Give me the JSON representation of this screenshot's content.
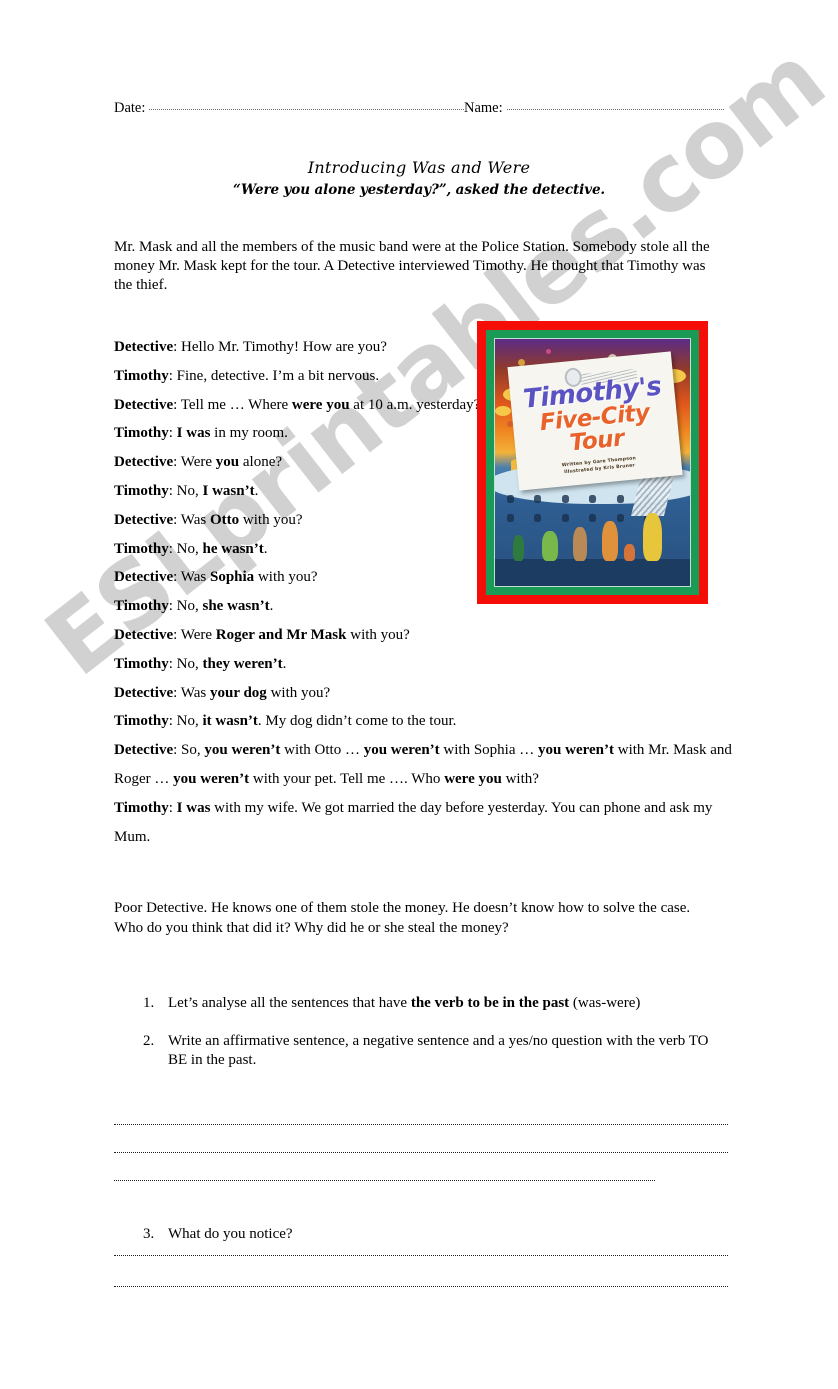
{
  "watermark": {
    "text": "ESLprintables.com"
  },
  "header": {
    "date_label": "Date:",
    "name_label": "Name:"
  },
  "titles": {
    "main": "Introducing Was and Were",
    "sub": "“Were you alone yesterday?”, asked the detective."
  },
  "intro": "Mr. Mask and all the members of the music band were at the Police Station. Somebody stole all the money Mr. Mask kept for the tour. A Detective interviewed Timothy. He thought that Timothy was the thief.",
  "dialogue": [
    {
      "speaker": "Detective",
      "parts": [
        {
          "t": ": Hello Mr. Timothy! How are you?",
          "b": false
        }
      ]
    },
    {
      "speaker": "Timothy",
      "parts": [
        {
          "t": ": Fine, detective. I’m a bit nervous.",
          "b": false
        }
      ]
    },
    {
      "speaker": "Detective",
      "parts": [
        {
          "t": ": Tell me … Where ",
          "b": false
        },
        {
          "t": "were you",
          "b": true
        },
        {
          "t": " at 10 a.m. yesterday?",
          "b": false
        }
      ]
    },
    {
      "speaker": "Timothy",
      "parts": [
        {
          "t": ": ",
          "b": false
        },
        {
          "t": "I was",
          "b": true
        },
        {
          "t": " in my room.",
          "b": false
        }
      ]
    },
    {
      "speaker": "Detective",
      "parts": [
        {
          "t": ": Were ",
          "b": false
        },
        {
          "t": "you",
          "b": true
        },
        {
          "t": " alone?",
          "b": false
        }
      ]
    },
    {
      "speaker": "Timothy",
      "parts": [
        {
          "t": ": No, ",
          "b": false
        },
        {
          "t": "I wasn’t",
          "b": true
        },
        {
          "t": ".",
          "b": false
        }
      ]
    },
    {
      "speaker": "Detective",
      "parts": [
        {
          "t": ": Was ",
          "b": false
        },
        {
          "t": "Otto",
          "b": true
        },
        {
          "t": " with you?",
          "b": false
        }
      ]
    },
    {
      "speaker": "Timothy",
      "parts": [
        {
          "t": ": No, ",
          "b": false
        },
        {
          "t": "he wasn’t",
          "b": true
        },
        {
          "t": ".",
          "b": false
        }
      ]
    },
    {
      "speaker": "Detective",
      "parts": [
        {
          "t": ": Was ",
          "b": false
        },
        {
          "t": "Sophia",
          "b": true
        },
        {
          "t": " with you?",
          "b": false
        }
      ]
    },
    {
      "speaker": "Timothy",
      "parts": [
        {
          "t": ": No, ",
          "b": false
        },
        {
          "t": "she wasn’t",
          "b": true
        },
        {
          "t": ".",
          "b": false
        }
      ]
    },
    {
      "speaker": "Detective",
      "parts": [
        {
          "t": ": Were ",
          "b": false
        },
        {
          "t": "Roger and Mr Mask",
          "b": true
        },
        {
          "t": " with you?",
          "b": false
        }
      ]
    },
    {
      "speaker": "Timothy",
      "parts": [
        {
          "t": ": No, ",
          "b": false
        },
        {
          "t": "they weren’t",
          "b": true
        },
        {
          "t": ".",
          "b": false
        }
      ]
    },
    {
      "speaker": "Detective",
      "parts": [
        {
          "t": ": Was ",
          "b": false
        },
        {
          "t": "your dog",
          "b": true
        },
        {
          "t": " with you?",
          "b": false
        }
      ]
    },
    {
      "speaker": "Timothy",
      "parts": [
        {
          "t": ": No, ",
          "b": false
        },
        {
          "t": "it wasn’t",
          "b": true
        },
        {
          "t": ". My dog didn’t come to the tour.",
          "b": false
        }
      ]
    },
    {
      "speaker": "Detective",
      "parts": [
        {
          "t": ": So, ",
          "b": false
        },
        {
          "t": "you weren’t",
          "b": true
        },
        {
          "t": " with Otto … ",
          "b": false
        },
        {
          "t": "you weren’t",
          "b": true
        },
        {
          "t": " with Sophia … ",
          "b": false
        },
        {
          "t": "you weren’t",
          "b": true
        },
        {
          "t": " with Mr. Mask and Roger … ",
          "b": false
        },
        {
          "t": "you weren’t",
          "b": true
        },
        {
          "t": " with your pet. Tell me …. Who ",
          "b": false
        },
        {
          "t": "were you",
          "b": true
        },
        {
          "t": " with?",
          "b": false
        }
      ]
    },
    {
      "speaker": "Timothy",
      "parts": [
        {
          "t": ": ",
          "b": false
        },
        {
          "t": "I was",
          "b": true
        },
        {
          "t": " with my wife. We got married the day before yesterday. You can phone and ask my Mum.",
          "b": false
        }
      ]
    }
  ],
  "book_cover": {
    "title_line1": "Timothy's",
    "title_line2": "Five-City Tour",
    "credit_line1": "Written by Gare Thompson",
    "credit_line2": "Illustrated by Kris Bruner",
    "colors": {
      "outer_border": "#f50d08",
      "inner_border": "#1b9a55",
      "title1": "#5b52c4",
      "title2": "#e8622a"
    }
  },
  "closing": {
    "line1": "Poor Detective. He knows one of them stole the money. He doesn’t know how to solve the case.",
    "line2": "Who do you think that did it? Why did he or she steal the money?"
  },
  "tasks": [
    {
      "num": "1.",
      "parts": [
        {
          "t": "Let’s analyse all the sentences that have ",
          "b": false
        },
        {
          "t": "the verb to be in the past",
          "b": true
        },
        {
          "t": " (was-were)",
          "b": false
        }
      ]
    },
    {
      "num": "2.",
      "parts": [
        {
          "t": "Write an affirmative sentence, a negative sentence and a yes/no question with the verb TO BE in the past.",
          "b": false
        }
      ]
    }
  ],
  "question3": {
    "num": "3.",
    "text": "What do you notice?"
  }
}
